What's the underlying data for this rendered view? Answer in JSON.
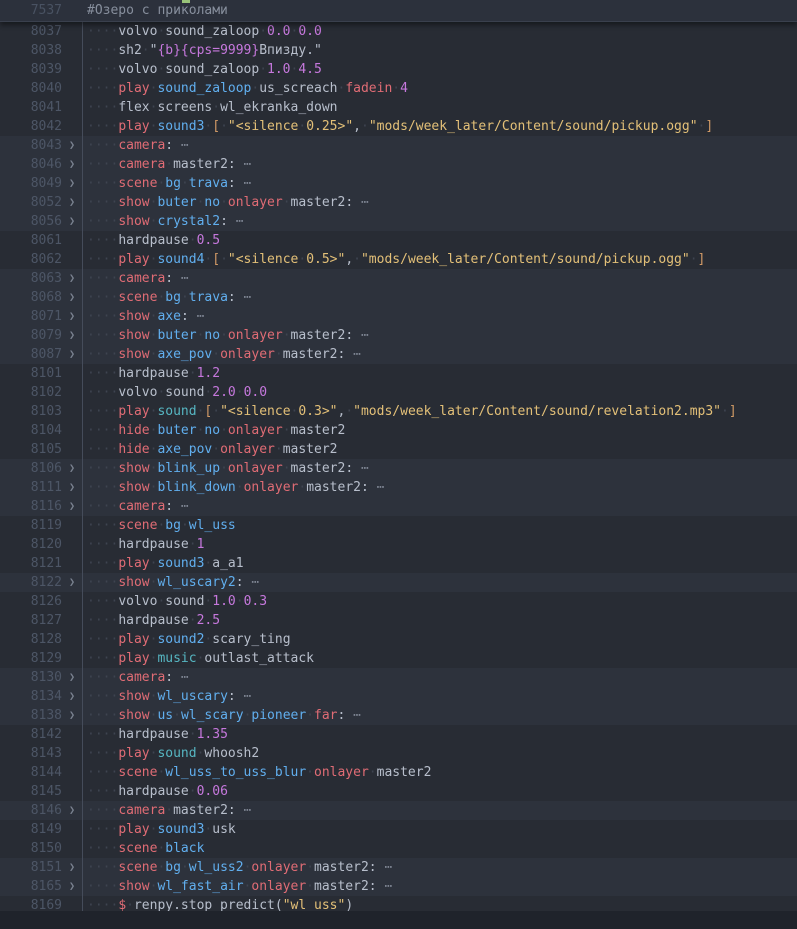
{
  "editor": {
    "sticky": {
      "line": "7537",
      "text": "#Озеро с приколами"
    },
    "colors": {
      "background": "#282c34",
      "row_highlight": "#2d323c",
      "keyword_red": "#e06c75",
      "entity_blue": "#61afef",
      "builtin_teal": "#56b6c2",
      "number_magenta": "#c678dd",
      "string_gold": "#e3c078",
      "bracket_gold": "#d19a66",
      "default_text": "#b8bfcc",
      "line_number": "#4d5666",
      "comment": "#878f9d"
    },
    "icons": {
      "fold_chevron": "❯",
      "fold_ellipsis": "⋯",
      "whitespace_dot": "·"
    },
    "rows": [
      {
        "n": "8037",
        "f": false,
        "h": false,
        "e": false,
        "t": [
          [
            "w",
            "volvo sound_zaloop "
          ],
          [
            "m",
            "0.0 "
          ],
          [
            "m",
            "0.0"
          ]
        ]
      },
      {
        "n": "8038",
        "f": false,
        "h": false,
        "e": false,
        "t": [
          [
            "w",
            "sh2 \""
          ],
          [
            "m",
            "{b}{cps=9999}"
          ],
          [
            "w",
            "Впизду.\""
          ]
        ]
      },
      {
        "n": "8039",
        "f": false,
        "h": false,
        "e": false,
        "t": [
          [
            "w",
            "volvo sound_zaloop "
          ],
          [
            "m",
            "1.0 "
          ],
          [
            "m",
            "4.5"
          ]
        ]
      },
      {
        "n": "8040",
        "f": false,
        "h": false,
        "e": false,
        "t": [
          [
            "k",
            "play "
          ],
          [
            "b",
            "sound_zaloop "
          ],
          [
            "w",
            "us_screach "
          ],
          [
            "k",
            "fadein "
          ],
          [
            "m",
            "4"
          ]
        ]
      },
      {
        "n": "8041",
        "f": false,
        "h": false,
        "e": false,
        "t": [
          [
            "w",
            "flex screens wl_ekranka_down"
          ]
        ]
      },
      {
        "n": "8042",
        "f": false,
        "h": false,
        "e": false,
        "t": [
          [
            "k",
            "play "
          ],
          [
            "b",
            "sound3 "
          ],
          [
            "r",
            "[ "
          ],
          [
            "s",
            "\"<silence 0.25>\""
          ],
          [
            "w",
            ", "
          ],
          [
            "s",
            "\"mods/week_later/Content/sound/pickup.ogg\""
          ],
          [
            "r",
            " ]"
          ]
        ]
      },
      {
        "n": "8043",
        "f": true,
        "h": true,
        "e": true,
        "t": [
          [
            "k",
            "camera"
          ],
          [
            "w",
            ":"
          ]
        ]
      },
      {
        "n": "8046",
        "f": true,
        "h": true,
        "e": true,
        "t": [
          [
            "k",
            "camera "
          ],
          [
            "w",
            "master2:"
          ]
        ]
      },
      {
        "n": "8049",
        "f": true,
        "h": true,
        "e": true,
        "t": [
          [
            "k",
            "scene "
          ],
          [
            "b",
            "bg trava"
          ],
          [
            "w",
            ":"
          ]
        ]
      },
      {
        "n": "8052",
        "f": true,
        "h": true,
        "e": true,
        "t": [
          [
            "k",
            "show "
          ],
          [
            "b",
            "buter no "
          ],
          [
            "k",
            "onlayer "
          ],
          [
            "w",
            "master2:"
          ]
        ]
      },
      {
        "n": "8056",
        "f": true,
        "h": true,
        "e": true,
        "t": [
          [
            "k",
            "show "
          ],
          [
            "b",
            "crystal2"
          ],
          [
            "w",
            ":"
          ]
        ]
      },
      {
        "n": "8061",
        "f": false,
        "h": false,
        "e": false,
        "t": [
          [
            "w",
            "hardpause "
          ],
          [
            "m",
            "0.5"
          ]
        ]
      },
      {
        "n": "8062",
        "f": false,
        "h": false,
        "e": false,
        "t": [
          [
            "k",
            "play "
          ],
          [
            "b",
            "sound4 "
          ],
          [
            "r",
            "[ "
          ],
          [
            "s",
            "\"<silence 0.5>\""
          ],
          [
            "w",
            ", "
          ],
          [
            "s",
            "\"mods/week_later/Content/sound/pickup.ogg\""
          ],
          [
            "r",
            " ]"
          ]
        ]
      },
      {
        "n": "8063",
        "f": true,
        "h": true,
        "e": true,
        "t": [
          [
            "k",
            "camera"
          ],
          [
            "w",
            ":"
          ]
        ]
      },
      {
        "n": "8068",
        "f": true,
        "h": true,
        "e": true,
        "t": [
          [
            "k",
            "scene "
          ],
          [
            "b",
            "bg trava"
          ],
          [
            "w",
            ":"
          ]
        ]
      },
      {
        "n": "8071",
        "f": true,
        "h": true,
        "e": true,
        "t": [
          [
            "k",
            "show "
          ],
          [
            "b",
            "axe"
          ],
          [
            "w",
            ":"
          ]
        ]
      },
      {
        "n": "8079",
        "f": true,
        "h": true,
        "e": true,
        "t": [
          [
            "k",
            "show "
          ],
          [
            "b",
            "buter no "
          ],
          [
            "k",
            "onlayer "
          ],
          [
            "w",
            "master2:"
          ]
        ]
      },
      {
        "n": "8087",
        "f": true,
        "h": true,
        "e": true,
        "t": [
          [
            "k",
            "show "
          ],
          [
            "b",
            "axe_pov "
          ],
          [
            "k",
            "onlayer "
          ],
          [
            "w",
            "master2:"
          ]
        ]
      },
      {
        "n": "8101",
        "f": false,
        "h": false,
        "e": false,
        "t": [
          [
            "w",
            "hardpause "
          ],
          [
            "m",
            "1.2"
          ]
        ]
      },
      {
        "n": "8102",
        "f": false,
        "h": false,
        "e": false,
        "t": [
          [
            "w",
            "volvo sound "
          ],
          [
            "m",
            "2.0 "
          ],
          [
            "m",
            "0.0"
          ]
        ]
      },
      {
        "n": "8103",
        "f": false,
        "h": false,
        "e": false,
        "t": [
          [
            "k",
            "play "
          ],
          [
            "t",
            "sound "
          ],
          [
            "r",
            "[ "
          ],
          [
            "s",
            "\"<silence 0.3>\""
          ],
          [
            "w",
            ", "
          ],
          [
            "s",
            "\"mods/week_later/Content/sound/revelation2.mp3\""
          ],
          [
            "r",
            " ]"
          ]
        ]
      },
      {
        "n": "8104",
        "f": false,
        "h": false,
        "e": false,
        "t": [
          [
            "k",
            "hide "
          ],
          [
            "b",
            "buter no "
          ],
          [
            "k",
            "onlayer "
          ],
          [
            "w",
            "master2"
          ]
        ]
      },
      {
        "n": "8105",
        "f": false,
        "h": false,
        "e": false,
        "t": [
          [
            "k",
            "hide "
          ],
          [
            "b",
            "axe_pov "
          ],
          [
            "k",
            "onlayer "
          ],
          [
            "w",
            "master2"
          ]
        ]
      },
      {
        "n": "8106",
        "f": true,
        "h": true,
        "e": true,
        "t": [
          [
            "k",
            "show "
          ],
          [
            "b",
            "blink_up "
          ],
          [
            "k",
            "onlayer "
          ],
          [
            "w",
            "master2:"
          ]
        ]
      },
      {
        "n": "8111",
        "f": true,
        "h": true,
        "e": true,
        "t": [
          [
            "k",
            "show "
          ],
          [
            "b",
            "blink_down "
          ],
          [
            "k",
            "onlayer "
          ],
          [
            "w",
            "master2:"
          ]
        ]
      },
      {
        "n": "8116",
        "f": true,
        "h": true,
        "e": true,
        "t": [
          [
            "k",
            "camera"
          ],
          [
            "w",
            ":"
          ]
        ]
      },
      {
        "n": "8119",
        "f": false,
        "h": false,
        "e": false,
        "t": [
          [
            "k",
            "scene "
          ],
          [
            "b",
            "bg wl_uss"
          ]
        ]
      },
      {
        "n": "8120",
        "f": false,
        "h": false,
        "e": false,
        "t": [
          [
            "w",
            "hardpause "
          ],
          [
            "m",
            "1"
          ]
        ]
      },
      {
        "n": "8121",
        "f": false,
        "h": false,
        "e": false,
        "t": [
          [
            "k",
            "play "
          ],
          [
            "b",
            "sound3 "
          ],
          [
            "w",
            "a_a1"
          ]
        ]
      },
      {
        "n": "8122",
        "f": true,
        "h": true,
        "e": true,
        "t": [
          [
            "k",
            "show "
          ],
          [
            "b",
            "wl_uscary2"
          ],
          [
            "w",
            ":"
          ]
        ]
      },
      {
        "n": "8126",
        "f": false,
        "h": false,
        "e": false,
        "t": [
          [
            "w",
            "volvo sound "
          ],
          [
            "m",
            "1.0 "
          ],
          [
            "m",
            "0.3"
          ]
        ]
      },
      {
        "n": "8127",
        "f": false,
        "h": false,
        "e": false,
        "t": [
          [
            "w",
            "hardpause "
          ],
          [
            "m",
            "2.5"
          ]
        ]
      },
      {
        "n": "8128",
        "f": false,
        "h": false,
        "e": false,
        "t": [
          [
            "k",
            "play "
          ],
          [
            "b",
            "sound2 "
          ],
          [
            "w",
            "scary_ting"
          ]
        ]
      },
      {
        "n": "8129",
        "f": false,
        "h": false,
        "e": false,
        "t": [
          [
            "k",
            "play "
          ],
          [
            "t",
            "music "
          ],
          [
            "w",
            "outlast_attack"
          ]
        ]
      },
      {
        "n": "8130",
        "f": true,
        "h": true,
        "e": true,
        "t": [
          [
            "k",
            "camera"
          ],
          [
            "w",
            ":"
          ]
        ]
      },
      {
        "n": "8134",
        "f": true,
        "h": true,
        "e": true,
        "t": [
          [
            "k",
            "show "
          ],
          [
            "b",
            "wl_uscary"
          ],
          [
            "w",
            ":"
          ]
        ]
      },
      {
        "n": "8138",
        "f": true,
        "h": true,
        "e": true,
        "t": [
          [
            "k",
            "show "
          ],
          [
            "b",
            "us wl_scary pioneer "
          ],
          [
            "k",
            "far"
          ],
          [
            "w",
            ":"
          ]
        ]
      },
      {
        "n": "8142",
        "f": false,
        "h": false,
        "e": false,
        "t": [
          [
            "w",
            "hardpause "
          ],
          [
            "m",
            "1.35"
          ]
        ]
      },
      {
        "n": "8143",
        "f": false,
        "h": false,
        "e": false,
        "t": [
          [
            "k",
            "play "
          ],
          [
            "t",
            "sound "
          ],
          [
            "w",
            "whoosh2"
          ]
        ]
      },
      {
        "n": "8144",
        "f": false,
        "h": false,
        "e": false,
        "t": [
          [
            "k",
            "scene "
          ],
          [
            "b",
            "wl_uss_to_uss_blur "
          ],
          [
            "k",
            "onlayer "
          ],
          [
            "w",
            "master2"
          ]
        ]
      },
      {
        "n": "8145",
        "f": false,
        "h": false,
        "e": false,
        "t": [
          [
            "w",
            "hardpause "
          ],
          [
            "m",
            "0.06"
          ]
        ]
      },
      {
        "n": "8146",
        "f": true,
        "h": true,
        "e": true,
        "t": [
          [
            "k",
            "camera "
          ],
          [
            "w",
            "master2:"
          ]
        ]
      },
      {
        "n": "8149",
        "f": false,
        "h": false,
        "e": false,
        "t": [
          [
            "k",
            "play "
          ],
          [
            "b",
            "sound3 "
          ],
          [
            "w",
            "usk"
          ]
        ]
      },
      {
        "n": "8150",
        "f": false,
        "h": false,
        "e": false,
        "t": [
          [
            "k",
            "scene "
          ],
          [
            "b",
            "black"
          ]
        ]
      },
      {
        "n": "8151",
        "f": true,
        "h": true,
        "e": true,
        "t": [
          [
            "k",
            "scene "
          ],
          [
            "b",
            "bg wl_uss2 "
          ],
          [
            "k",
            "onlayer "
          ],
          [
            "w",
            "master2:"
          ]
        ]
      },
      {
        "n": "8165",
        "f": true,
        "h": true,
        "e": true,
        "t": [
          [
            "k",
            "show "
          ],
          [
            "b",
            "wl_fast_air "
          ],
          [
            "k",
            "onlayer "
          ],
          [
            "w",
            "master2:"
          ]
        ]
      },
      {
        "n": "8169",
        "f": false,
        "h": false,
        "e": false,
        "t": [
          [
            "k",
            "$ "
          ],
          [
            "w",
            "renpy.stop_predict("
          ],
          [
            "s",
            "\"wl_uss\""
          ],
          [
            "w",
            ")"
          ]
        ]
      }
    ]
  }
}
